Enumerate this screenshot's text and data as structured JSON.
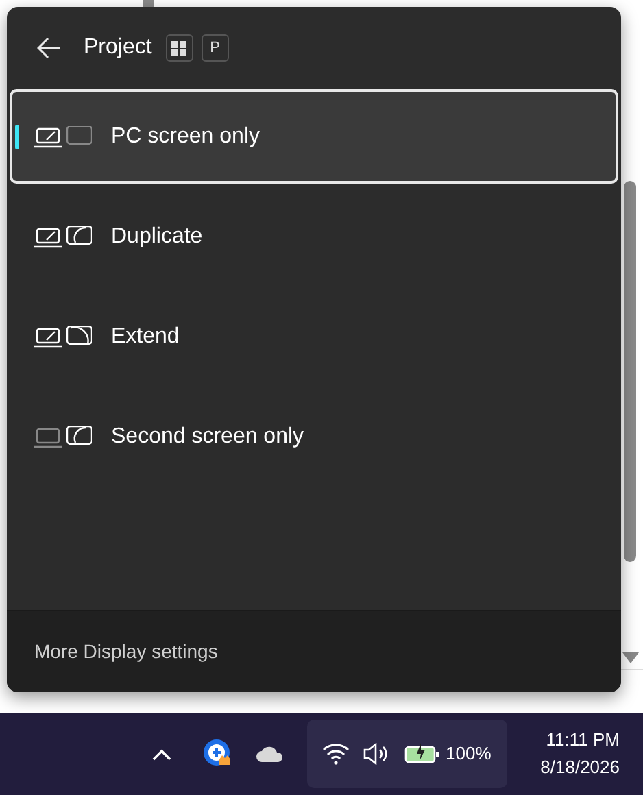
{
  "panel": {
    "title": "Project",
    "shortcut": [
      {
        "kind": "windows"
      },
      {
        "kind": "letter",
        "text": "P"
      }
    ],
    "options": [
      {
        "label": "PC screen only",
        "kind": "pc_only",
        "selected": true
      },
      {
        "label": "Duplicate",
        "kind": "duplicate",
        "selected": false
      },
      {
        "label": "Extend",
        "kind": "extend",
        "selected": false
      },
      {
        "label": "Second screen only",
        "kind": "second_only",
        "selected": false
      }
    ],
    "footer_link": "More Display settings"
  },
  "taskbar": {
    "battery_text": "100%",
    "time": "11:11 PM",
    "date": "8/18/2026"
  }
}
